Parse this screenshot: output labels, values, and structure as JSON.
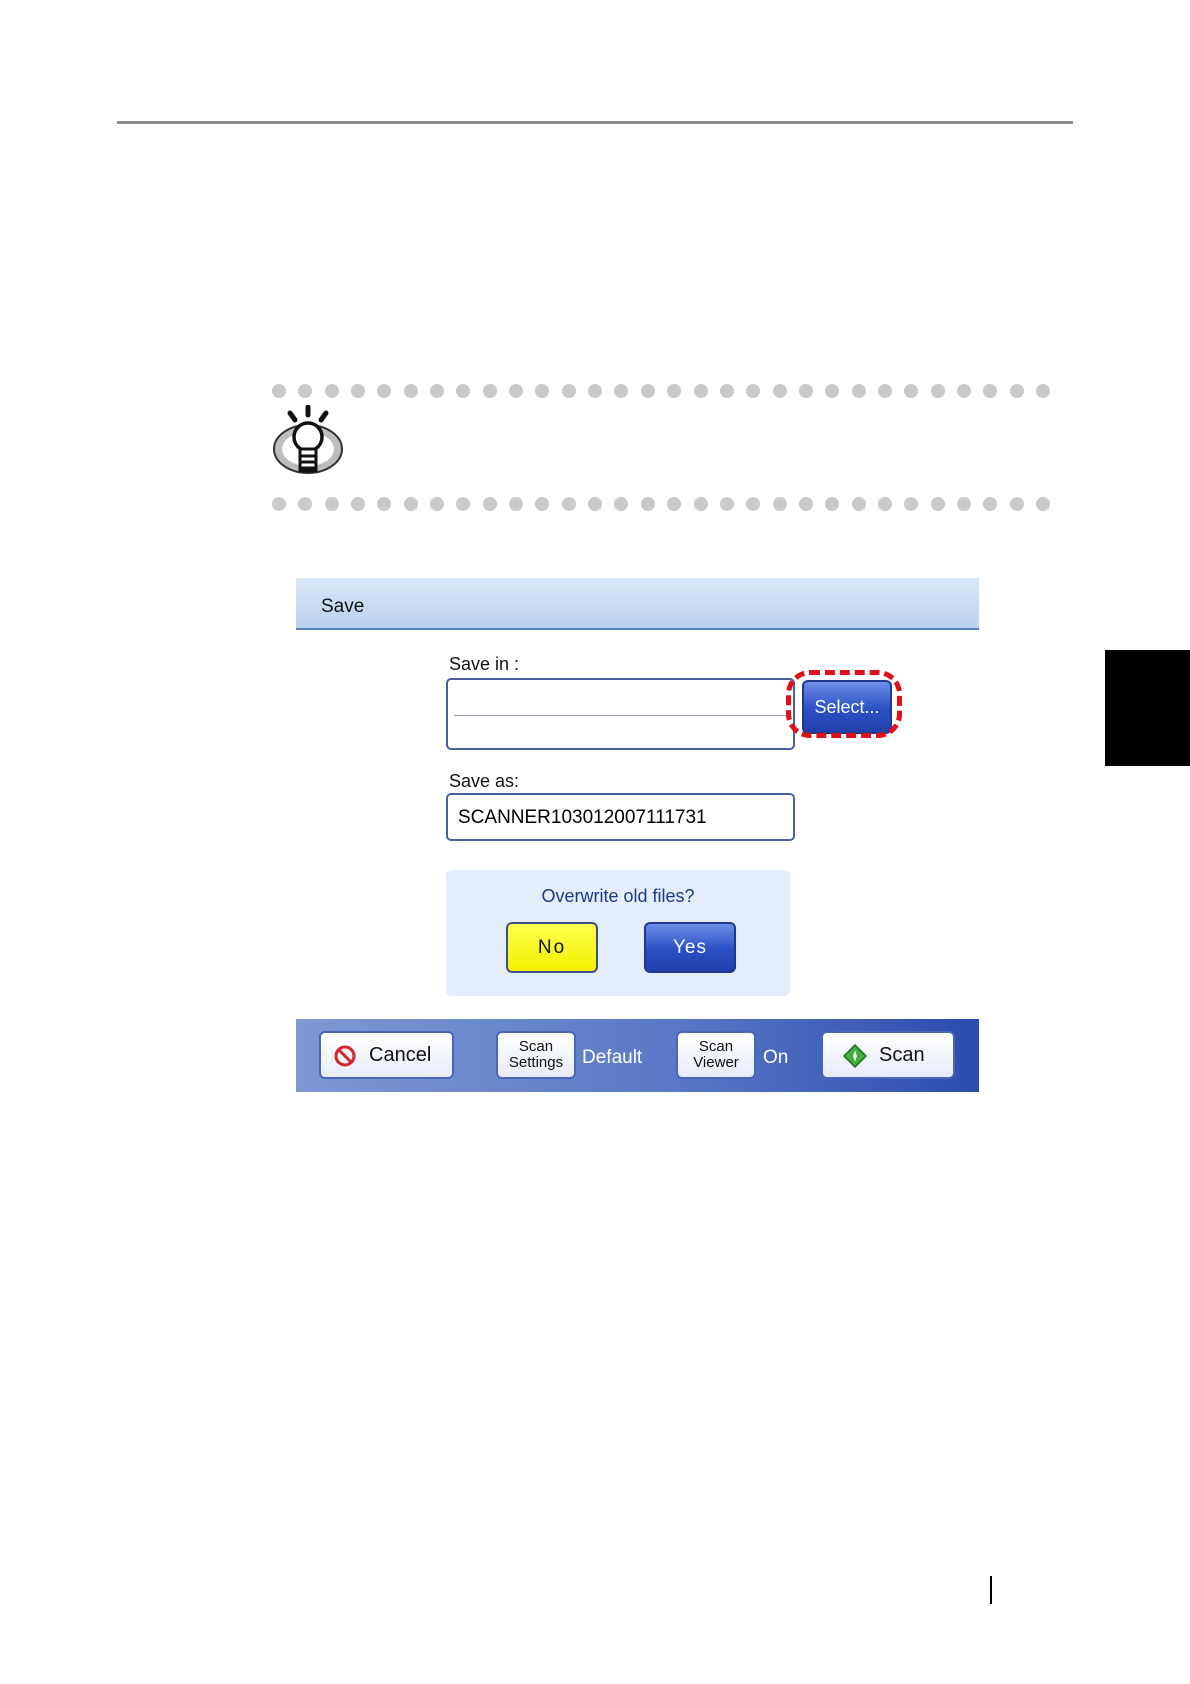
{
  "page": {
    "hint": {
      "icon": "hint-lightbulb-icon"
    },
    "side_tab_color": "#000000"
  },
  "dialog": {
    "title": "Save",
    "save_in": {
      "label": "Save in :",
      "value": "",
      "select_button": "Select..."
    },
    "save_as": {
      "label": "Save as:",
      "value": "SCANNER103012007111731"
    },
    "overwrite": {
      "question": "Overwrite old files?",
      "no_label": "No",
      "yes_label": "Yes"
    },
    "bottom_bar": {
      "cancel_label": "Cancel",
      "scan_settings_label_1": "Scan",
      "scan_settings_label_2": "Settings",
      "scan_settings_value": "Default",
      "scan_viewer_label_1": "Scan",
      "scan_viewer_label_2": "Viewer",
      "scan_viewer_value": "On",
      "scan_label": "Scan"
    },
    "colors": {
      "highlight": "#e10f1a",
      "no_button": "#ffff00",
      "accent_blue": "#2b4fc4"
    }
  }
}
